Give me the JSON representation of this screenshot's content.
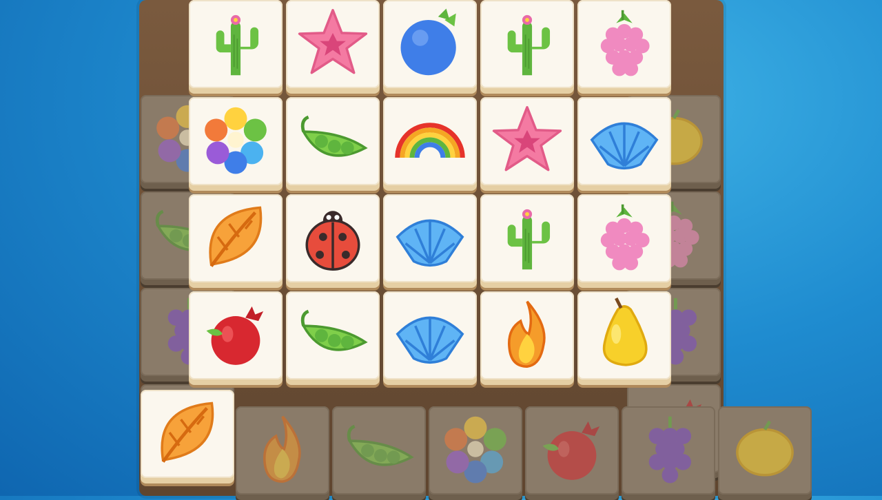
{
  "game": {
    "name": "tile-match-board",
    "grid": {
      "rows": 4,
      "cols": 5,
      "tiles": [
        [
          "cactus",
          "starfish",
          "blueberry",
          "cactus",
          "raspberry"
        ],
        [
          "flower",
          "peapod",
          "rainbow",
          "starfish",
          "shell"
        ],
        [
          "leaf",
          "ladybug",
          "shell",
          "cactus",
          "raspberry"
        ],
        [
          "pomegranate",
          "peapod",
          "shell",
          "fire",
          "pear"
        ]
      ]
    },
    "selected_tile": "leaf",
    "background_peeks": {
      "left_column": [
        "flower",
        "peapod",
        "grape",
        "flower"
      ],
      "right_column": [
        "lemon",
        "raspberry",
        "grape",
        "pomegranate"
      ],
      "bottom_row": [
        "fire",
        "peapod",
        "flower",
        "pomegranate",
        "grape",
        "lemon"
      ]
    }
  },
  "colors": {
    "board_wood": "#6b4e35",
    "tile_face": "#fbf7ee",
    "tile_edge": "#e5cfa4",
    "background_blue": "#1f8cd0"
  }
}
